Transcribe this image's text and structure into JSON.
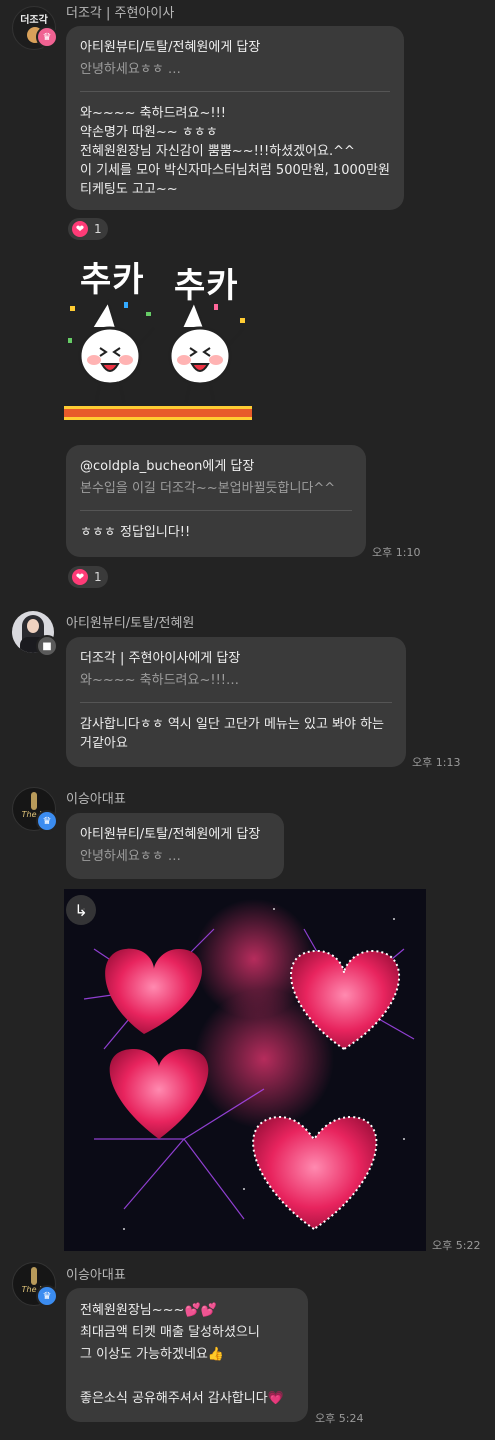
{
  "messages": [
    {
      "sender": "더조각 | 주현아이사",
      "avatar_text": "더조각",
      "reply_to": "아티원뷰티/토탈/전혜원에게 답장",
      "reply_preview": "안녕하세요ㅎㅎ …",
      "body": "와~~~~ 축하드려요~!!!\n약손명가 따원~~ ㅎㅎㅎ\n전혜원원장님 자신감이 뿜뿜~~!!!하셨겠어요.^^\n 이 기세를 모아 박신자마스터님처럼 500만원, 1000만원 티케팅도 고고~~",
      "reaction_count": "1"
    },
    {
      "sticker_words": [
        "추카",
        "추카"
      ]
    },
    {
      "reply_to": "@coldpla_bucheon에게 답장",
      "reply_preview": "본수입을 이길 더조각~~본업바뀔듯합니다^^",
      "body": "ㅎㅎㅎ 정답입니다!!",
      "time": "오후 1:10",
      "reaction_count": "1"
    },
    {
      "sender": "아티원뷰티/토탈/전혜원",
      "reply_to": "더조각 | 주현아이사에게 답장",
      "reply_preview": "와~~~~ 축하드려요~!!!…",
      "body": "감사합니다ㅎㅎ 역시 일단 고단가 메뉴는 있고 봐야 하는 거같아요",
      "time": "오후 1:13"
    },
    {
      "sender": "이승아대표",
      "avatar_text": "The Je",
      "reply_to": "아티원뷰티/토탈/전혜원에게 답장",
      "reply_preview": "안녕하세요ㅎㅎ …",
      "time": "오후 5:22"
    },
    {
      "sender": "이승아대표",
      "avatar_text": "The Je",
      "body": "전혜원원장님~~~💕💕\n최대금액 티켓 매출 달성하셨으니\n그 이상도 가능하겠네요👍\n\n좋은소식 공유해주셔서 감사합니다💗",
      "time": "오후 5:24"
    }
  ],
  "colors": {
    "background": "#232323",
    "bubble": "#3a3a3a",
    "reaction_heart": "#ff3b77",
    "badge_pink": "#f06292",
    "badge_blue": "#3b8cf0"
  },
  "icons": {
    "share": "↳",
    "heart": "❤",
    "crown": "♛"
  }
}
